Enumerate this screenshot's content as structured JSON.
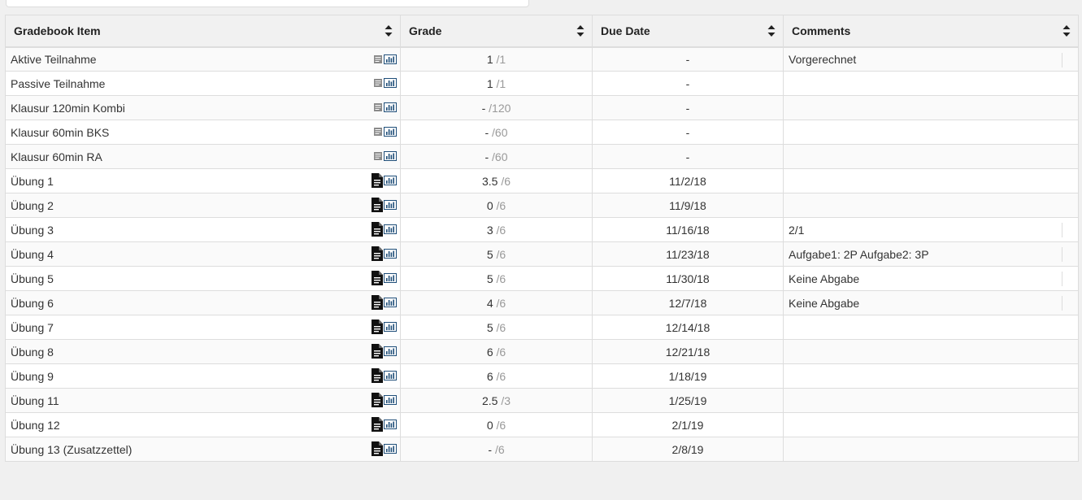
{
  "table": {
    "headers": {
      "item": "Gradebook Item",
      "grade": "Grade",
      "due": "Due Date",
      "comments": "Comments"
    },
    "rows": [
      {
        "item": "Aktive Teilnahme",
        "type": "external",
        "grade": "1",
        "max": "/1",
        "due": "-",
        "comment": "Vorgerechnet"
      },
      {
        "item": "Passive Teilnahme",
        "type": "external",
        "grade": "1",
        "max": "/1",
        "due": "-",
        "comment": ""
      },
      {
        "item": "Klausur 120min Kombi",
        "type": "external",
        "grade": "-",
        "max": "/120",
        "due": "-",
        "comment": ""
      },
      {
        "item": "Klausur 60min BKS",
        "type": "external",
        "grade": "-",
        "max": "/60",
        "due": "-",
        "comment": ""
      },
      {
        "item": "Klausur 60min RA",
        "type": "external",
        "grade": "-",
        "max": "/60",
        "due": "-",
        "comment": ""
      },
      {
        "item": "Übung 1",
        "type": "assignment",
        "grade": "3.5",
        "max": "/6",
        "due": "11/2/18",
        "comment": ""
      },
      {
        "item": "Übung 2",
        "type": "assignment",
        "grade": "0",
        "max": "/6",
        "due": "11/9/18",
        "comment": ""
      },
      {
        "item": "Übung 3",
        "type": "assignment",
        "grade": "3",
        "max": "/6",
        "due": "11/16/18",
        "comment": "2/1"
      },
      {
        "item": "Übung 4",
        "type": "assignment",
        "grade": "5",
        "max": "/6",
        "due": "11/23/18",
        "comment": "Aufgabe1: 2P Aufgabe2: 3P"
      },
      {
        "item": "Übung 5",
        "type": "assignment",
        "grade": "5",
        "max": "/6",
        "due": "11/30/18",
        "comment": "Keine Abgabe"
      },
      {
        "item": "Übung 6",
        "type": "assignment",
        "grade": "4",
        "max": "/6",
        "due": "12/7/18",
        "comment": "Keine Abgabe"
      },
      {
        "item": "Übung 7",
        "type": "assignment",
        "grade": "5",
        "max": "/6",
        "due": "12/14/18",
        "comment": ""
      },
      {
        "item": "Übung 8",
        "type": "assignment",
        "grade": "6",
        "max": "/6",
        "due": "12/21/18",
        "comment": ""
      },
      {
        "item": "Übung 9",
        "type": "assignment",
        "grade": "6",
        "max": "/6",
        "due": "1/18/19",
        "comment": ""
      },
      {
        "item": "Übung 11",
        "type": "assignment",
        "grade": "2.5",
        "max": "/3",
        "due": "1/25/19",
        "comment": ""
      },
      {
        "item": "Übung 12",
        "type": "assignment",
        "grade": "0",
        "max": "/6",
        "due": "2/1/19",
        "comment": ""
      },
      {
        "item": "Übung 13 (Zusatzzettel)",
        "type": "assignment",
        "grade": "-",
        "max": "/6",
        "due": "2/8/19",
        "comment": ""
      }
    ]
  },
  "icons": {
    "external": "gradebook-book-icon",
    "assignment": "document-icon",
    "stats": "bar-chart-icon",
    "sort": "sort-arrows-icon"
  },
  "colors": {
    "header_bg": "#f1f1f1",
    "border": "#ddd",
    "stats_blue": "#1f4e79"
  }
}
